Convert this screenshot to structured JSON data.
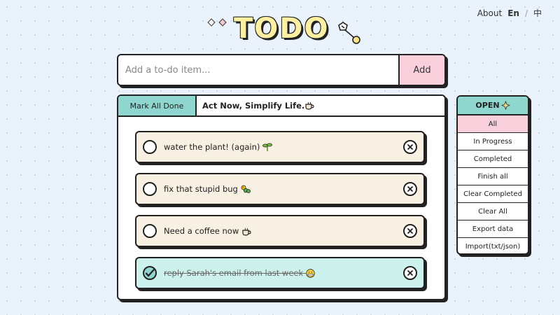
{
  "nav": {
    "about": "About",
    "lang_en": "En",
    "lang_sep": "/",
    "lang_zh": "中"
  },
  "logo": {
    "title": "TODO"
  },
  "input": {
    "placeholder": "Add a to-do item...",
    "add_label": "Add"
  },
  "panel": {
    "mark_all_label": "Mark All Done",
    "slogan": "Act Now, Simplify Life."
  },
  "todos": [
    {
      "text": "water the plant! (again)",
      "done": false,
      "icon": "sprout-icon"
    },
    {
      "text": "fix that stupid bug",
      "done": false,
      "icon": "caterpillar-icon"
    },
    {
      "text": "Need a coffee now",
      "done": false,
      "icon": "coffee-cup-icon"
    },
    {
      "text": "reply Sarah's email from last week",
      "done": true,
      "icon": "grimace-face-icon"
    }
  ],
  "sidebar": {
    "header": "OPEN",
    "items": [
      {
        "label": "All",
        "active": true
      },
      {
        "label": "In Progress"
      },
      {
        "label": "Completed"
      },
      {
        "label": "Finish all"
      },
      {
        "label": "Clear Completed"
      },
      {
        "label": "Clear All"
      },
      {
        "label": "Export data"
      },
      {
        "label": "Import(txt/json)"
      }
    ]
  },
  "colors": {
    "accent_teal": "#8fd6cf",
    "accent_pink": "#f9cfdc",
    "item_bg": "#f8f0e2",
    "done_bg": "#cdf1ec",
    "logo_yellow": "#fdf0a2"
  }
}
